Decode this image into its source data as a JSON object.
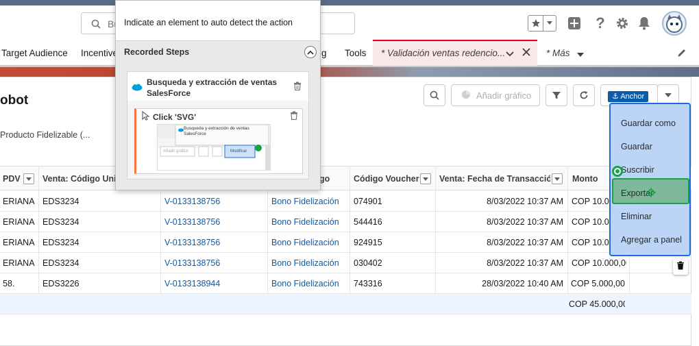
{
  "header": {
    "search_placeholder": "Bu",
    "icons": [
      "star-icon",
      "add-icon",
      "help-icon",
      "gear-icon",
      "bell-icon",
      "avatar"
    ]
  },
  "nav": {
    "items": [
      "Target Audience",
      "Incentive",
      "g",
      "Tools"
    ],
    "active_tab": "* Validación ventas redencio...",
    "more": "* Más"
  },
  "page": {
    "title": "obot",
    "subtitle": "Producto Fidelizable (...",
    "add_chart_label": "Añadir gráfico",
    "anchor_badge": "Anchor"
  },
  "recorder": {
    "hint": "Indicate an element to auto detect the action",
    "recorded_steps_label": "Recorded Steps",
    "step_group_title": "Busqueda y extracción de ventas SalesForce",
    "step_click_label": "Click 'SVG'",
    "thumb_title": "Busqueda y extracción de ventas SalesForce",
    "thumb_chart_label": "Añadir gráfico",
    "thumb_button_label": "Modificar"
  },
  "table": {
    "headers": [
      "PDV",
      "Venta: Código Uni",
      "",
      "go",
      "Código Voucher",
      "Venta: Fecha de Transacción",
      "Monto"
    ],
    "rows": [
      [
        "ERIANA",
        "EDS3234",
        "V-0133138756",
        "Bono Fidelización",
        "074901",
        "8/03/2022 10:37 AM",
        "COP 10.000,"
      ],
      [
        "ERIANA",
        "EDS3234",
        "V-0133138756",
        "Bono Fidelización",
        "544416",
        "8/03/2022 10:37 AM",
        "COP 10.000,"
      ],
      [
        "ERIANA",
        "EDS3234",
        "V-0133138756",
        "Bono Fidelización",
        "924915",
        "8/03/2022 10:37 AM",
        "COP 10.000,"
      ],
      [
        "ERIANA",
        "EDS3234",
        "V-0133138756",
        "Bono Fidelización",
        "030402",
        "8/03/2022 10:37 AM",
        "COP 10.000,00"
      ],
      [
        "58.",
        "EDS3226",
        "V-0133138944",
        "Bono Fidelización",
        "743316",
        "28/03/2022 10:40 AM",
        "COP 5.000,00"
      ]
    ],
    "total": "COP 45.000,00"
  },
  "menu": {
    "items": [
      "Guardar como",
      "Guardar",
      "Suscribir",
      "Exportar",
      "Eliminar",
      "Agregar a panel"
    ]
  },
  "colors": {
    "link": "#0b5cab",
    "menu_bg": "#bcd4f5",
    "menu_border": "#1b6ce0",
    "highlight": "#18a34a",
    "active_tab_bg": "#fbe9e9"
  }
}
